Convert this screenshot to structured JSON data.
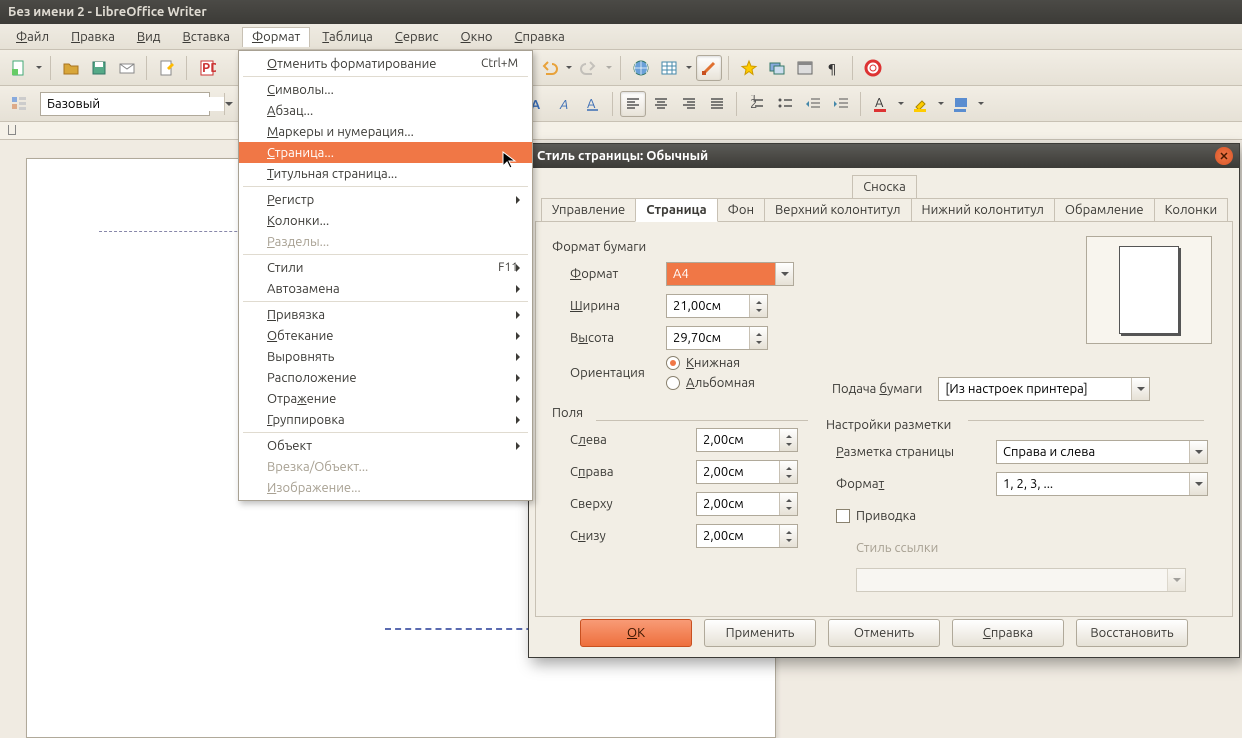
{
  "window": {
    "title": "Без имени 2 - LibreOffice Writer"
  },
  "menubar": [
    "Файл",
    "Правка",
    "Вид",
    "Вставка",
    "Формат",
    "Таблица",
    "Сервис",
    "Окно",
    "Справка"
  ],
  "menubar_u": [
    "Ф",
    "П",
    "В",
    "В",
    "Ф",
    "Т",
    "С",
    "О",
    "С"
  ],
  "active_menu_index": 4,
  "style_combo": {
    "value": "Базовый"
  },
  "dropdown": {
    "items": [
      {
        "label": "Отменить форматирование",
        "u": "О",
        "shortcut": "Ctrl+M"
      },
      {
        "sep": true
      },
      {
        "label": "Символы...",
        "u": "С"
      },
      {
        "label": "Абзац...",
        "u": "А"
      },
      {
        "label": "Маркеры и нумерация...",
        "u": "М"
      },
      {
        "label": "Страница...",
        "u": "С",
        "hl": true
      },
      {
        "label": "Титульная страница...",
        "u": "Т"
      },
      {
        "sep": true
      },
      {
        "label": "Регистр",
        "u": "Р",
        "sub": true
      },
      {
        "label": "Колонки...",
        "u": "К"
      },
      {
        "label": "Разделы...",
        "u": "Р",
        "dis": true
      },
      {
        "sep": true
      },
      {
        "label": "Стили",
        "shortcut": "F11",
        "sub": true
      },
      {
        "label": "Автозамена",
        "sub": true
      },
      {
        "sep": true
      },
      {
        "label": "Привязка",
        "u": "П",
        "sub": true
      },
      {
        "label": "Обтекание",
        "u": "О",
        "sub": true
      },
      {
        "label": "Выровнять",
        "sub": true
      },
      {
        "label": "Расположение",
        "sub": true
      },
      {
        "label": "Отражение",
        "u": "ж",
        "sub": true
      },
      {
        "label": "Группировка",
        "u": "Г",
        "sub": true
      },
      {
        "sep": true
      },
      {
        "label": "Объект",
        "sub": true
      },
      {
        "label": "Врезка/Объект...",
        "dis": true
      },
      {
        "label": "Изображение...",
        "u": "И",
        "dis": true
      }
    ]
  },
  "dialog": {
    "title": "Стиль страницы: Обычный",
    "tabs_top": [
      "Сноска"
    ],
    "tabs": [
      "Управление",
      "Страница",
      "Фон",
      "Верхний колонтитул",
      "Нижний колонтитул",
      "Обрамление",
      "Колонки"
    ],
    "active_tab": 1,
    "paper": {
      "section": "Формат бумаги",
      "format_label": "Формат",
      "format_u": "Ф",
      "format_value": "A4",
      "width_label": "Ширина",
      "width_u": "Ш",
      "width_value": "21,00см",
      "height_label": "Высота",
      "height_u": "ы",
      "height_value": "29,70см",
      "orient_label": "Ориентация",
      "orient_portrait": "Книжная",
      "orient_portrait_u": "К",
      "orient_landscape": "Альбомная",
      "orient_landscape_u": "А",
      "tray_label": "Подача бумаги",
      "tray_u": "б",
      "tray_value": "[Из настроек принтера]"
    },
    "margins": {
      "section": "Поля",
      "left_label": "Слева",
      "left_u": "л",
      "left_value": "2,00см",
      "right_label": "Справа",
      "right_u": "п",
      "right_value": "2,00см",
      "top_label": "Сверху",
      "top_value": "2,00см",
      "bottom_label": "Снизу",
      "bottom_u": "н",
      "bottom_value": "2,00см"
    },
    "layout": {
      "section": "Настройки разметки",
      "pagelayout_label": "Разметка страницы",
      "pagelayout_u": "Р",
      "pagelayout_value": "Справа и слева",
      "format_label": "Формат",
      "format_u": "т",
      "format_value": "1, 2, 3, ...",
      "register_label": "Приводка",
      "refstyle_label": "Стиль ссылки",
      "refstyle_value": ""
    },
    "buttons": {
      "ok": "ОК",
      "ok_u": "О",
      "apply": "Применить",
      "cancel": "Отменить",
      "help": "Справка",
      "help_u": "С",
      "reset": "Восстановить"
    }
  }
}
